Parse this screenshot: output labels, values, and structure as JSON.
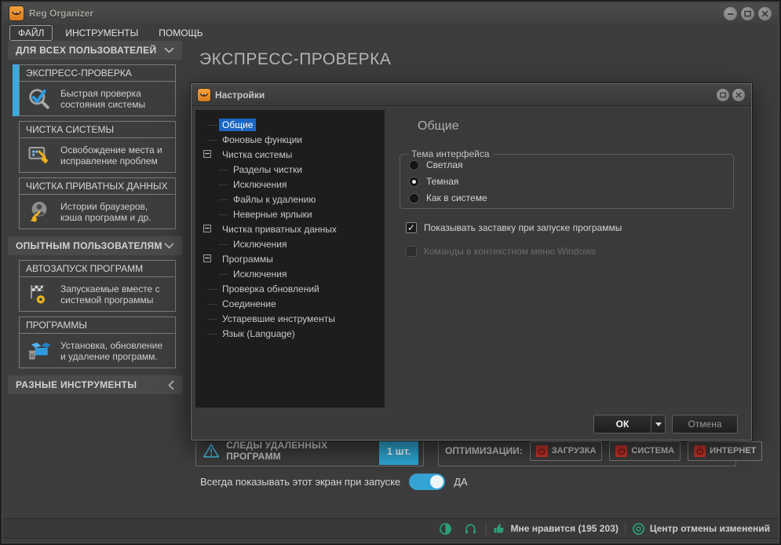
{
  "colors": {
    "accent_blue": "#3aabdc",
    "selection_blue": "#1b66c4",
    "badge_blue": "#2fa8d5",
    "danger_red": "#c7352c",
    "status_green": "#2aa07c"
  },
  "window": {
    "title": "Reg Organizer"
  },
  "menu": {
    "items": [
      {
        "label": "ФАЙЛ"
      },
      {
        "label": "ИНСТРУМЕНТЫ"
      },
      {
        "label": "ПОМОЩЬ"
      }
    ]
  },
  "sidebar": {
    "sections": [
      {
        "label": "ДЛЯ ВСЕХ ПОЛЬЗОВАТЕЛЕЙ",
        "chevron": "down"
      },
      {
        "label": "ОПЫТНЫМ ПОЛЬЗОВАТЕЛЯМ",
        "chevron": "down"
      },
      {
        "label": "РАЗНЫЕ ИНСТРУМЕНТЫ",
        "chevron": "left"
      }
    ],
    "cards": [
      {
        "title": "ЭКСПРЕСС-ПРОВЕРКА",
        "desc": "Быстрая проверка состояния системы",
        "icon": "magnifier-check-icon",
        "selected": true
      },
      {
        "title": "ЧИСТКА СИСТЕМЫ",
        "desc": "Освобождение места и исправление проблем",
        "icon": "monitor-broom-icon",
        "selected": false
      },
      {
        "title": "ЧИСТКА ПРИВАТНЫХ ДАННЫХ",
        "desc": "Истории браузеров, кэша программ и др.",
        "icon": "user-broom-icon",
        "selected": false
      },
      {
        "title": "АВТОЗАПУСК ПРОГРАММ",
        "desc": "Запускаемые вместе с системой программы",
        "icon": "flag-gear-icon",
        "selected": false
      },
      {
        "title": "ПРОГРАММЫ",
        "desc": "Установка, обновление и удаление программ.",
        "icon": "box-trash-icon",
        "selected": false
      }
    ]
  },
  "main": {
    "heading": "ЭКСПРЕСС-ПРОВЕРКА",
    "traces": {
      "label": "СЛЕДЫ УДАЛЕННЫХ ПРОГРАММ",
      "badge": "1 шт."
    },
    "optimizations": {
      "label": "ОПТИМИЗАЦИИ:",
      "buttons": [
        {
          "label": "ЗАГРУЗКА"
        },
        {
          "label": "СИСТЕМА"
        },
        {
          "label": "ИНТЕРНЕТ"
        }
      ]
    },
    "startup_toggle": {
      "label": "Всегда показывать этот экран при запуске",
      "value": "ДА",
      "on": true
    }
  },
  "statusbar": {
    "like_label": "Мне нравится (195 203)",
    "undo_label": "Центр отмены изменений"
  },
  "dialog": {
    "title": "Настройки",
    "tree": [
      {
        "label": "Общие",
        "level": 0,
        "selected": true
      },
      {
        "label": "Фоновые функции",
        "level": 0
      },
      {
        "label": "Чистка системы",
        "level": 0,
        "expanded": true
      },
      {
        "label": "Разделы чистки",
        "level": 1
      },
      {
        "label": "Исключения",
        "level": 1
      },
      {
        "label": "Файлы к удалению",
        "level": 1
      },
      {
        "label": "Неверные ярлыки",
        "level": 1
      },
      {
        "label": "Чистка приватных данных",
        "level": 0,
        "expanded": true
      },
      {
        "label": "Исключения",
        "level": 1
      },
      {
        "label": "Программы",
        "level": 0,
        "expanded": true
      },
      {
        "label": "Исключения",
        "level": 1
      },
      {
        "label": "Проверка обновлений",
        "level": 0
      },
      {
        "label": "Соединение",
        "level": 0
      },
      {
        "label": "Устаревшие инструменты",
        "level": 0
      },
      {
        "label": "Язык (Language)",
        "level": 0
      }
    ],
    "panel": {
      "heading": "Общие",
      "theme_group": {
        "label": "Тема интерфейса",
        "options": [
          {
            "label": "Светлая",
            "selected": false
          },
          {
            "label": "Темная",
            "selected": true
          },
          {
            "label": "Как в системе",
            "selected": false
          }
        ]
      },
      "checkboxes": [
        {
          "label": "Показывать заставку при запуске программы",
          "checked": true,
          "enabled": true
        },
        {
          "label": "Команды в контекстном меню Windows",
          "checked": false,
          "enabled": false
        }
      ]
    },
    "buttons": {
      "ok": "ОК",
      "cancel": "Отмена"
    }
  }
}
